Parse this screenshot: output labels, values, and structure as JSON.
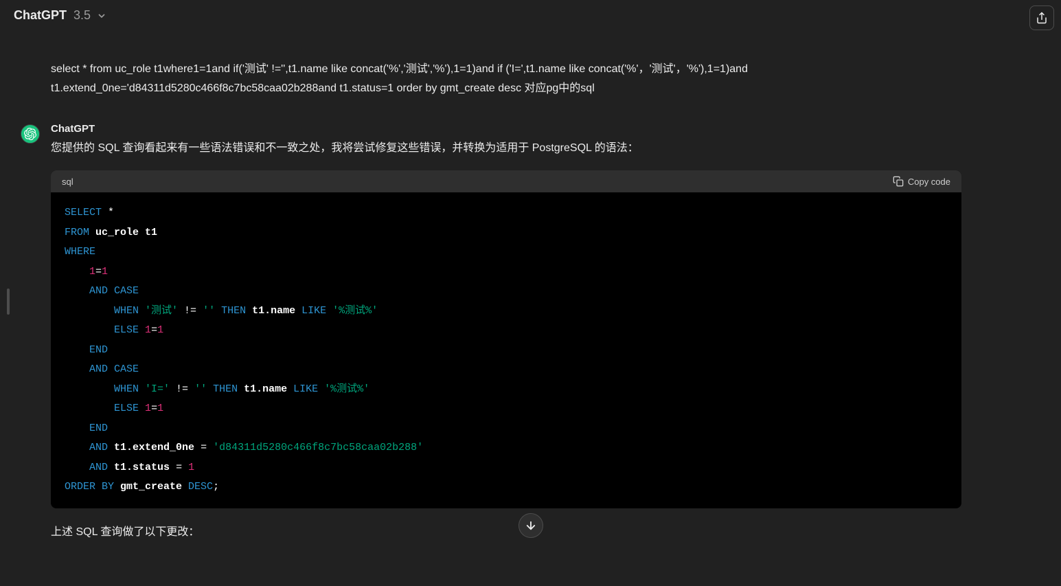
{
  "header": {
    "title": "ChatGPT",
    "version": "3.5"
  },
  "share_tooltip": "Share",
  "messages": {
    "user": {
      "text": "select * from uc_role t1where1=1and if('测试' !='',t1.name like concat('%','测试','%'),1=1)and if  ('I=',t1.name like concat('%'，'测试'，'%'),1=1)and t1.extend_0ne='d84311d5280c466f8c7bc58caa02b288and t1.status=1 order by gmt_create desc 对应pg中的sql"
    },
    "assistant": {
      "name": "ChatGPT",
      "intro": "您提供的 SQL 查询看起来有一些语法错误和不一致之处，我将尝试修复这些错误，并转换为适用于 PostgreSQL 的语法：",
      "code_lang": "sql",
      "copy_label": "Copy code",
      "code_tokens": {
        "l1_select": "SELECT",
        "l1_star": " *",
        "l2_from": "FROM",
        "l2_table": " uc_role t1",
        "l3_where": "WHERE",
        "l4_sp": "    ",
        "l4_one_a": "1",
        "l4_eq": "=",
        "l4_one_b": "1",
        "l5_sp": "    ",
        "l5_and": "AND",
        "l5_case": " CASE",
        "l6_sp": "        ",
        "l6_when": "WHEN",
        "l6_s1": " '测试'",
        "l6_ne": " != ",
        "l6_s2": "''",
        "l6_then": " THEN ",
        "l6_id": "t1.name",
        "l6_like": " LIKE ",
        "l6_s3": "'%测试%'",
        "l7_sp": "        ",
        "l7_else": "ELSE",
        "l7_sp2": " ",
        "l7_one_a": "1",
        "l7_eq": "=",
        "l7_one_b": "1",
        "l8_sp": "    ",
        "l8_end": "END",
        "l9_sp": "    ",
        "l9_and": "AND",
        "l9_case": " CASE",
        "l10_sp": "        ",
        "l10_when": "WHEN",
        "l10_s1": " 'I='",
        "l10_ne": " != ",
        "l10_s2": "''",
        "l10_then": " THEN ",
        "l10_id": "t1.name",
        "l10_like": " LIKE ",
        "l10_s3": "'%测试%'",
        "l11_sp": "        ",
        "l11_else": "ELSE",
        "l11_sp2": " ",
        "l11_one_a": "1",
        "l11_eq": "=",
        "l11_one_b": "1",
        "l12_sp": "    ",
        "l12_end": "END",
        "l13_sp": "    ",
        "l13_and": "AND",
        "l13_id": " t1.extend_0ne ",
        "l13_eq": "=",
        "l13_sp2": " ",
        "l13_str": "'d84311d5280c466f8c7bc58caa02b288'",
        "l14_sp": "    ",
        "l14_and": "AND",
        "l14_id": " t1.status ",
        "l14_eq": "= ",
        "l14_num": "1",
        "l15_order": "ORDER BY",
        "l15_id": " gmt_create ",
        "l15_desc": "DESC",
        "l15_semi": ";"
      },
      "trailing": "上述 SQL 查询做了以下更改："
    }
  }
}
